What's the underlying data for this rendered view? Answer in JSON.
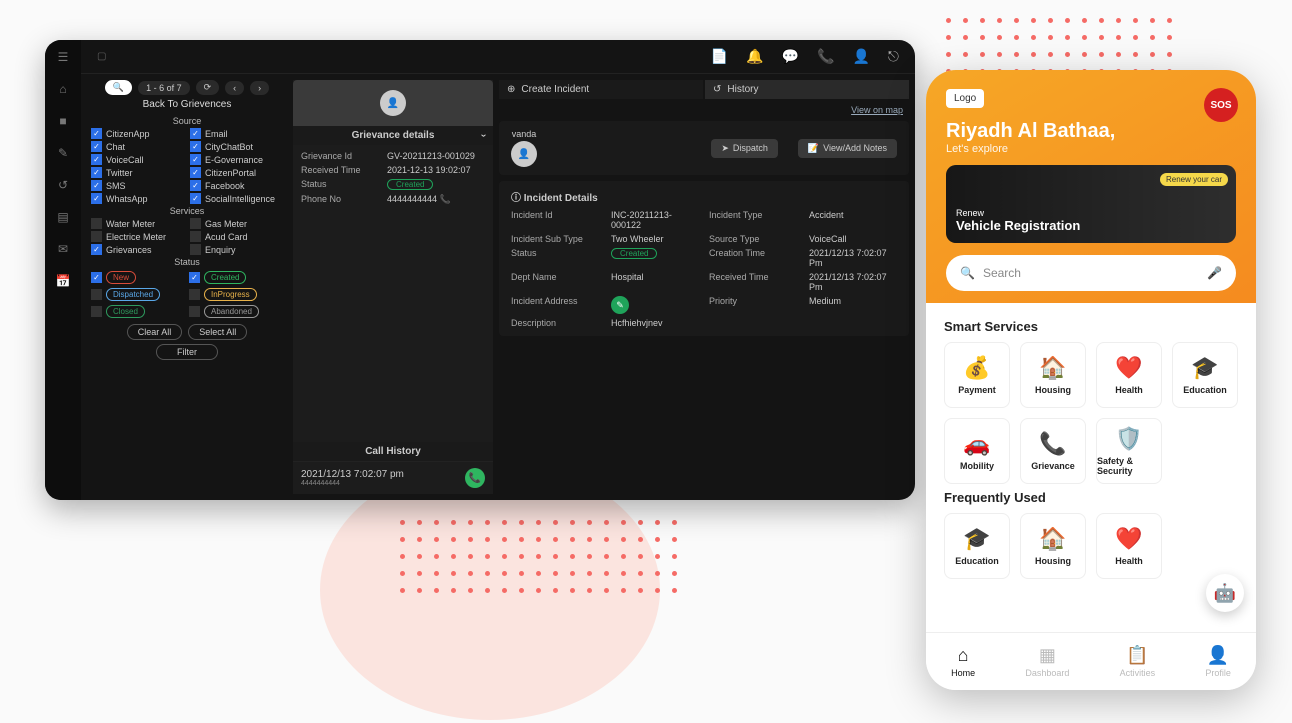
{
  "decor": {},
  "dashboard": {
    "topbar": {
      "title": ""
    },
    "pager": {
      "range": "1 - 6  of  7"
    },
    "back_label": "Back To Grievences",
    "sections": {
      "source": {
        "title": "Source",
        "left": [
          "CitizenApp",
          "Chat",
          "VoiceCall",
          "Twitter",
          "SMS",
          "WhatsApp"
        ],
        "right": [
          "Email",
          "CityChatBot",
          "E-Governance",
          "CitizenPortal",
          "Facebook",
          "SocialIntelligence"
        ]
      },
      "services": {
        "title": "Services",
        "left": [
          "Water Meter",
          "Electrice Meter",
          "Grievances"
        ],
        "right": [
          "Gas Meter",
          "Acud Card",
          "Enquiry"
        ]
      },
      "status": {
        "title": "Status",
        "items": [
          {
            "label": "New",
            "color": "#d84c3a",
            "checked": true
          },
          {
            "label": "Created",
            "color": "#2fb560",
            "checked": true
          },
          {
            "label": "Dispatched",
            "color": "#5aa8e8",
            "checked": false
          },
          {
            "label": "InProgress",
            "color": "#e8b24a",
            "checked": false
          },
          {
            "label": "Closed",
            "color": "#2e9b5e",
            "checked": false
          },
          {
            "label": "Abandoned",
            "color": "#999",
            "checked": false
          }
        ]
      },
      "clear_label": "Clear All",
      "select_label": "Select All",
      "filter_label": "Filter"
    },
    "grievance": {
      "header": "Grievance details",
      "fields": {
        "id_k": "Grievance Id",
        "id_v": "GV-20211213-001029",
        "rt_k": "Received Time",
        "rt_v": "2021-12-13 19:02:07",
        "st_k": "Status",
        "st_v": "Created",
        "ph_k": "Phone No",
        "ph_v": "4444444444"
      },
      "call_history_title": "Call History",
      "call": {
        "time": "2021/12/13 7:02:07 pm",
        "sub": "4444444444"
      }
    },
    "tabs": {
      "create": "Create Incident",
      "history": "History"
    },
    "map_link": "View on map",
    "inc_top": {
      "caller": "vanda",
      "dispatch": "Dispatch",
      "notes": "View/Add Notes"
    },
    "incident": {
      "title": "Incident Details",
      "id_k": "Incident Id",
      "id_v": "INC-20211213-000122",
      "sub_k": "Incident Sub Type",
      "sub_v": "Two Wheeler",
      "stat_k": "Status",
      "stat_v": "Created",
      "dept_k": "Dept Name",
      "dept_v": "Hospital",
      "addr_k": "Incident Address",
      "desc_k": "Description",
      "desc_v": "Hcfhiehvjnev",
      "type_k": "Incident Type",
      "type_v": "Accident",
      "src_k": "Source Type",
      "src_v": "VoiceCall",
      "ct_k": "Creation Time",
      "ct_v": "2021/12/13 7:02:07 Pm",
      "rcv_k": "Received Time",
      "rcv_v": "2021/12/13 7:02:07 Pm",
      "pr_k": "Priority",
      "pr_v": "Medium"
    }
  },
  "mobile": {
    "logo": "Logo",
    "sos": "SOS",
    "heading": "Riyadh Al Bathaa,",
    "subheading": "Let's explore",
    "banner": {
      "badge": "Renew your car",
      "small": "Renew",
      "big": "Vehicle Registration"
    },
    "search": {
      "placeholder": "Search"
    },
    "smart_title": "Smart Services",
    "smart": [
      {
        "icon": "💰",
        "label": "Payment"
      },
      {
        "icon": "🏠",
        "label": "Housing"
      },
      {
        "icon": "❤️",
        "label": "Health"
      },
      {
        "icon": "🎓",
        "label": "Education"
      },
      {
        "icon": "🚗",
        "label": "Mobility"
      },
      {
        "icon": "📞",
        "label": "Grievance"
      },
      {
        "icon": "🛡️",
        "label": "Safety & Security"
      }
    ],
    "freq_title": "Frequently Used",
    "freq": [
      {
        "icon": "🎓",
        "label": "Education"
      },
      {
        "icon": "🏠",
        "label": "Housing"
      },
      {
        "icon": "❤️",
        "label": "Health"
      }
    ],
    "tabs": [
      {
        "icon": "⌂",
        "label": "Home",
        "active": true
      },
      {
        "icon": "▦",
        "label": "Dashboard"
      },
      {
        "icon": "📋",
        "label": "Activities"
      },
      {
        "icon": "👤",
        "label": "Profile"
      }
    ]
  }
}
